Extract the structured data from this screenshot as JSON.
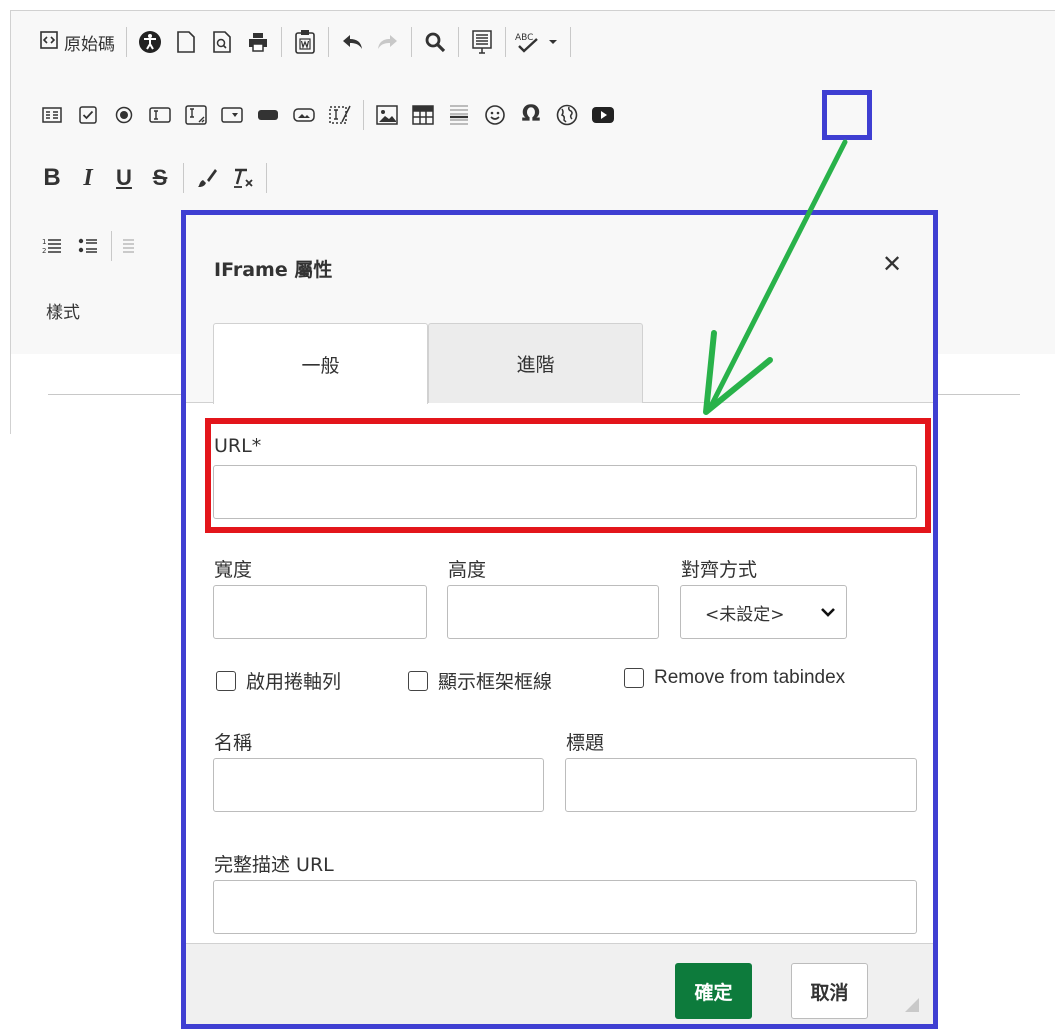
{
  "toolbar": {
    "source_label": "原始碼",
    "styles_label": "樣式",
    "format_buttons": {
      "bold": "B",
      "italic": "I",
      "underline": "U",
      "strike": "S"
    },
    "special_char": "Ω",
    "spellcheck_label": "ABC"
  },
  "dialog": {
    "title": "IFrame 屬性",
    "close_glyph": "✕",
    "tabs": [
      {
        "label": "一般",
        "active": true
      },
      {
        "label": "進階",
        "active": false
      }
    ],
    "url": {
      "label": "URL*",
      "value": "",
      "placeholder": ""
    },
    "width": {
      "label": "寬度",
      "value": ""
    },
    "height": {
      "label": "高度",
      "value": ""
    },
    "align": {
      "label": "對齊方式",
      "selected": "<未設定>"
    },
    "checkboxes": [
      {
        "label": "啟用捲軸列",
        "checked": false
      },
      {
        "label": "顯示框架框線",
        "checked": false
      },
      {
        "label": "Remove from tabindex",
        "checked": false
      }
    ],
    "name": {
      "label": "名稱",
      "value": ""
    },
    "title_field": {
      "label": "標題",
      "value": ""
    },
    "longdesc": {
      "label": "完整描述 URL",
      "value": ""
    },
    "ok_label": "確定",
    "cancel_label": "取消"
  },
  "colors": {
    "highlight_blue": "#3f3fd2",
    "highlight_red": "#e3151b",
    "arrow_green": "#29b24a",
    "ok_green": "#0d7b3c"
  }
}
